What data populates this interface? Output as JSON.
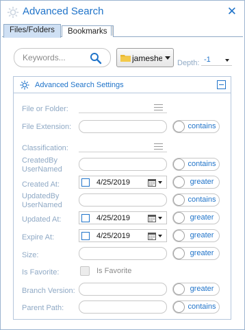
{
  "window": {
    "title": "Advanced Search",
    "close_glyph": "✕"
  },
  "tabs": [
    {
      "label": "Files/Folders",
      "active": true
    },
    {
      "label": "Bookmarks",
      "active": false
    }
  ],
  "search": {
    "placeholder": "Keywords...",
    "value": ""
  },
  "folder": {
    "value": "jameshec"
  },
  "depth": {
    "label": "Depth:",
    "value": "-1"
  },
  "settings": {
    "title": "Advanced Search Settings",
    "fields": {
      "file_or_folder": {
        "label": "File or Folder:"
      },
      "file_extension": {
        "label": "File Extension:",
        "value": "",
        "toggle": "contains"
      },
      "classification": {
        "label": "Classification:"
      },
      "created_by": {
        "label_line1": "CreatedBy",
        "label_line2": "UserNamed",
        "value": "",
        "toggle": "contains"
      },
      "created_at": {
        "label": "Created At:",
        "date": "4/25/2019",
        "toggle": "greater"
      },
      "updated_by": {
        "label_line1": "UpdatedBy",
        "label_line2": "UserNamed",
        "value": "",
        "toggle": "contains"
      },
      "updated_at": {
        "label": "Updated At:",
        "date": "4/25/2019",
        "toggle": "greater"
      },
      "expire_at": {
        "label": "Expire At:",
        "date": "4/25/2019",
        "toggle": "greater"
      },
      "size": {
        "label": "Size:",
        "value": "",
        "toggle": "greater"
      },
      "is_favorite": {
        "label": "Is Favorite:",
        "checkbox_label": "Is Favorite",
        "checked": false
      },
      "branch_version": {
        "label": "Branch Version:",
        "value": "",
        "toggle": "greater"
      },
      "parent_path": {
        "label": "Parent Path:",
        "value": "",
        "toggle": "contains"
      }
    }
  },
  "colors": {
    "accent": "#1f73c9",
    "label": "#8fa9c5",
    "border": "#c7c7c7"
  },
  "icons": {
    "title": "gear-icon",
    "search": "search-icon",
    "folder": "folder-icon",
    "settings": "gear-icon",
    "collapse": "minus-box-icon",
    "picker": "hamburger-icon",
    "calendar": "calendar-icon"
  }
}
